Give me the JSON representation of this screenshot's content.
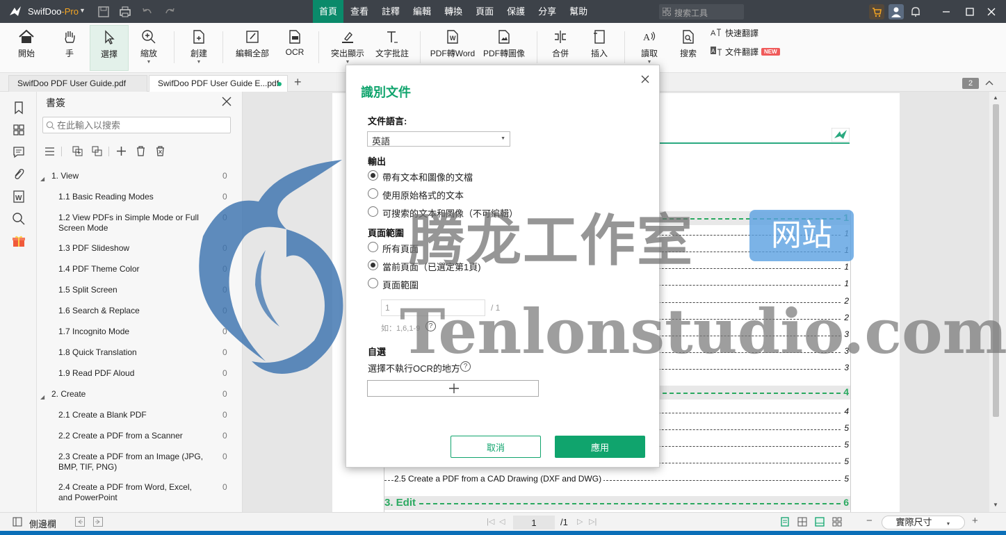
{
  "titlebar": {
    "app_name": "SwifDoo",
    "app_suffix": "-Pro",
    "menus": [
      "首頁",
      "查看",
      "註釋",
      "編輯",
      "轉換",
      "頁面",
      "保護",
      "分享",
      "幫助"
    ],
    "active_menu": "首頁",
    "search_placeholder": "搜索工具"
  },
  "ribbon": {
    "start": "開始",
    "hand": "手",
    "select": "選擇",
    "zoom": "縮放",
    "create": "創建",
    "edit_all": "編輯全部",
    "ocr": "OCR",
    "highlight": "突出顯示",
    "text_comment": "文字批註",
    "pdf_to_word": "PDF轉Word",
    "pdf_to_image": "PDF轉圖像",
    "merge": "合併",
    "insert": "插入",
    "read": "讀取",
    "search": "搜索",
    "quick_translate": "快速翻譯",
    "doc_translate": "文件翻譯",
    "new_badge": "NEW"
  },
  "tabs": [
    {
      "label": "SwifDoo PDF User Guide.pdf"
    },
    {
      "label": "SwifDoo PDF User Guide E...pdf"
    }
  ],
  "page_count_badge": "2",
  "bookmarks": {
    "title": "書簽",
    "search_placeholder": "在此輸入以搜索",
    "items": [
      {
        "label": "1. View",
        "count": "0"
      },
      {
        "label": "1.1 Basic Reading Modes",
        "count": "0"
      },
      {
        "label": "1.2 View PDFs in Simple Mode or Full Screen Mode",
        "count": "0"
      },
      {
        "label": "1.3 PDF Slideshow",
        "count": "0"
      },
      {
        "label": "1.4 PDF Theme Color",
        "count": "0"
      },
      {
        "label": "1.5 Split Screen",
        "count": "0"
      },
      {
        "label": "1.6 Search & Replace",
        "count": "0"
      },
      {
        "label": "1.7 Incognito Mode",
        "count": "0"
      },
      {
        "label": "1.8 Quick Translation",
        "count": "0"
      },
      {
        "label": "1.9 Read PDF Aloud",
        "count": "0"
      },
      {
        "label": "2. Create",
        "count": "0"
      },
      {
        "label": "2.1 Create a Blank PDF",
        "count": "0"
      },
      {
        "label": "2.2 Create a PDF from a Scanner",
        "count": "0"
      },
      {
        "label": "2.3 Create a PDF from an Image (JPG, BMP, TIF, PNG)",
        "count": "0"
      },
      {
        "label": "2.4 Create a PDF from Word, Excel, and PowerPoint",
        "count": "0"
      }
    ]
  },
  "document": {
    "toc": [
      {
        "text": "",
        "page": "1",
        "chapter": true
      },
      {
        "text": "",
        "page": "1"
      },
      {
        "text": "",
        "page": "1"
      },
      {
        "text": "",
        "page": "1"
      },
      {
        "text": "",
        "page": "1"
      },
      {
        "text": "",
        "page": "2"
      },
      {
        "text": "",
        "page": "2"
      },
      {
        "text": "",
        "page": "3"
      },
      {
        "text": "",
        "page": "3"
      },
      {
        "text": "",
        "page": "3"
      },
      {
        "text": "",
        "page": "4",
        "chapter": true
      },
      {
        "text": "",
        "page": "4"
      },
      {
        "text": "",
        "page": "5"
      },
      {
        "text": "",
        "page": "5"
      },
      {
        "text": "",
        "page": "5"
      },
      {
        "text": "2.5 Create a PDF from a CAD Drawing (DXF and DWG)",
        "page": "5"
      },
      {
        "text": "3. Edit",
        "page": "6",
        "chapter": true
      }
    ]
  },
  "dialog": {
    "title": "識別文件",
    "language_label": "文件語言:",
    "language_value": "英語",
    "output_label": "輸出",
    "output_options": [
      {
        "label": "帶有文本和圖像的文檔",
        "checked": true
      },
      {
        "label": "使用原始格式的文本",
        "checked": false
      },
      {
        "label": "可搜索的文本和圖像（不可編輯）",
        "checked": false
      }
    ],
    "range_label": "頁面範圍",
    "range_options": [
      {
        "label": "所有頁面",
        "checked": false
      },
      {
        "label": "當前頁面（已選定第1頁)",
        "checked": true
      },
      {
        "label": "頁面範圍",
        "checked": false
      }
    ],
    "range_input_value": "1",
    "range_total": "/ 1",
    "range_hint": "如：1,6,1-9",
    "optional_label": "自選",
    "exclude_label": "選擇不執行OCR的地方",
    "cancel": "取消",
    "apply": "應用"
  },
  "statusbar": {
    "sidebar_label": "側邊欄",
    "current_page": "1",
    "total_pages": "/1",
    "zoom": "實際尺寸"
  },
  "watermark": {
    "cn": "腾龙工作室",
    "badge": "网站",
    "en": "Tenlonstudio.com"
  },
  "colors": {
    "accent": "#10a46d",
    "titlebar": "#3d4249"
  }
}
